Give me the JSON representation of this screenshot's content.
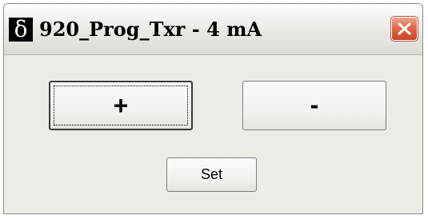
{
  "window": {
    "title": "920_Prog_Txr - 4 mA",
    "app_icon_glyph": "δ",
    "app_icon_name": "delta-app-icon",
    "close_icon_name": "close-icon",
    "close_color": "#e1684a"
  },
  "buttons": {
    "increment_label": "+",
    "decrement_label": "-",
    "set_label": "Set"
  },
  "colors": {
    "face": "#ecebe6",
    "focus_border": "#3a3a3a"
  }
}
